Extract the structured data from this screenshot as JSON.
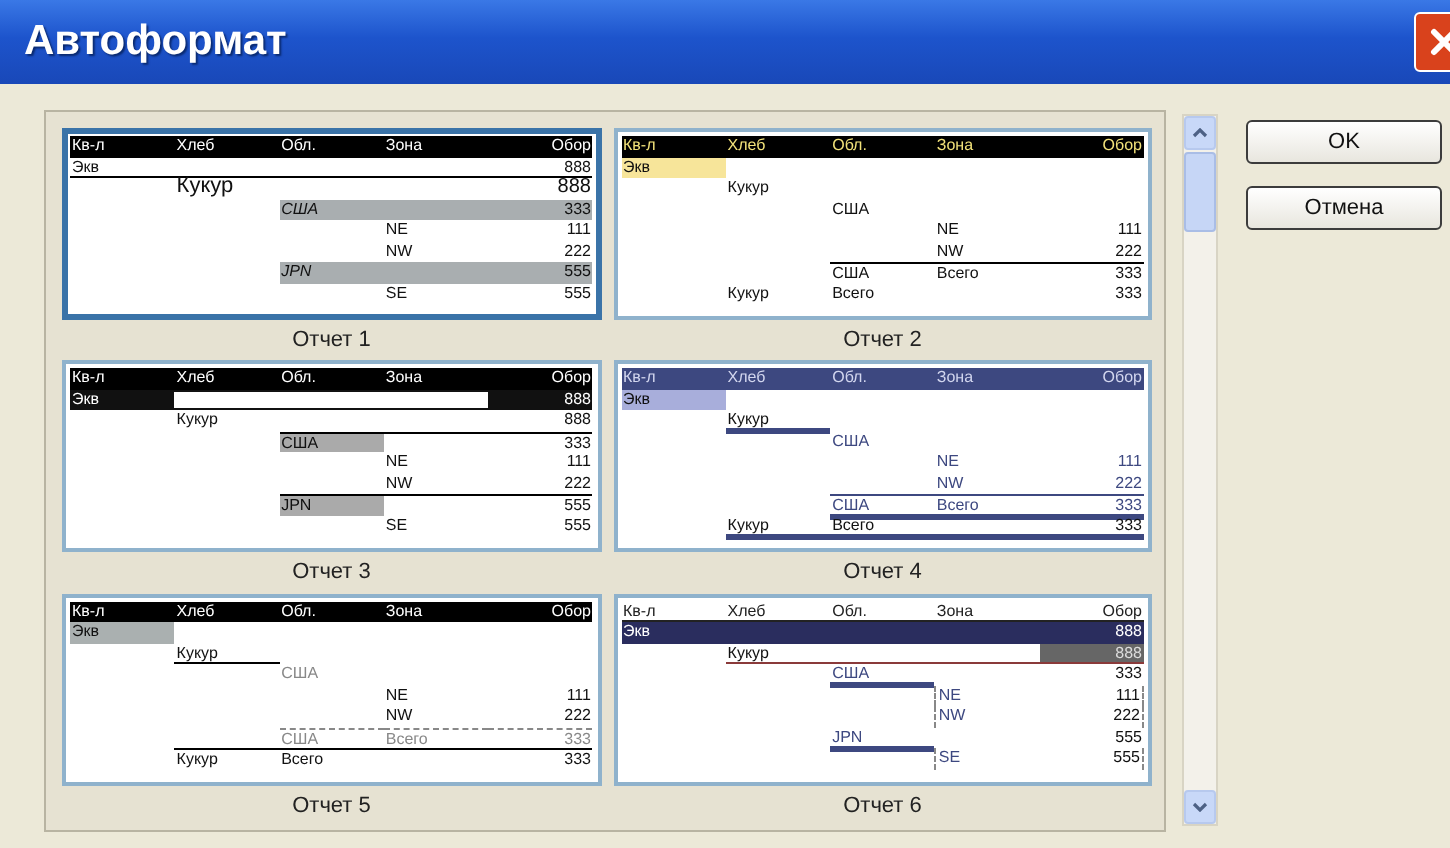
{
  "window": {
    "title": "Автоформат"
  },
  "reports": [
    {
      "label": "Отчет 1",
      "selected": true,
      "columns": [
        "Кв-л",
        "Хлеб",
        "Обл.",
        "Зона",
        "Обор"
      ],
      "rows": [
        {
          "kind": "total",
          "quarter": "Экв",
          "total": "888"
        },
        {
          "kind": "product",
          "bread": "Кукур",
          "total": "888"
        },
        {
          "kind": "region",
          "region": "США",
          "total": "333"
        },
        {
          "kind": "zone",
          "zone": "NE",
          "total": "111"
        },
        {
          "kind": "zone",
          "zone": "NW",
          "total": "222"
        },
        {
          "kind": "region",
          "region": "JPN",
          "total": "555"
        },
        {
          "kind": "zone",
          "zone": "SE",
          "total": "555"
        }
      ]
    },
    {
      "label": "Отчет 2",
      "selected": false,
      "columns": [
        "Кв-л",
        "Хлеб",
        "Обл.",
        "Зона",
        "Обор"
      ],
      "rows": [
        {
          "kind": "total",
          "quarter": "Экв"
        },
        {
          "kind": "product",
          "bread": "Кукур"
        },
        {
          "kind": "region",
          "region": "США"
        },
        {
          "kind": "zone",
          "zone": "NE",
          "total": "111"
        },
        {
          "kind": "zone",
          "zone": "NW",
          "total": "222"
        },
        {
          "kind": "subtotal",
          "region": "США",
          "zone": "Всего",
          "total": "333"
        },
        {
          "kind": "grand",
          "bread": "Кукур",
          "region": "Всего",
          "total": "333"
        }
      ]
    },
    {
      "label": "Отчет 3",
      "selected": false,
      "columns": [
        "Кв-л",
        "Хлеб",
        "Обл.",
        "Зона",
        "Обор"
      ],
      "rows": [
        {
          "kind": "total",
          "quarter": "Экв",
          "total": "888"
        },
        {
          "kind": "product",
          "bread": "Кукур",
          "total": "888"
        },
        {
          "kind": "region",
          "region": "США",
          "total": "333"
        },
        {
          "kind": "zone",
          "zone": "NE",
          "total": "111"
        },
        {
          "kind": "zone",
          "zone": "NW",
          "total": "222"
        },
        {
          "kind": "region",
          "region": "JPN",
          "total": "555"
        },
        {
          "kind": "zone",
          "zone": "SE",
          "total": "555"
        }
      ]
    },
    {
      "label": "Отчет 4",
      "selected": false,
      "columns": [
        "Кв-л",
        "Хлеб",
        "Обл.",
        "Зона",
        "Обор"
      ],
      "rows": [
        {
          "kind": "total",
          "quarter": "Экв"
        },
        {
          "kind": "product",
          "bread": "Кукур"
        },
        {
          "kind": "region",
          "region": "США"
        },
        {
          "kind": "zone",
          "zone": "NE",
          "total": "111"
        },
        {
          "kind": "zone",
          "zone": "NW",
          "total": "222"
        },
        {
          "kind": "subtotal",
          "region": "США",
          "zone": "Всего",
          "total": "333"
        },
        {
          "kind": "grand",
          "bread": "Кукур",
          "region": "Всего",
          "total": "333"
        }
      ]
    },
    {
      "label": "Отчет 5",
      "selected": false,
      "columns": [
        "Кв-л",
        "Хлеб",
        "Обл.",
        "Зона",
        "Обор"
      ],
      "rows": [
        {
          "kind": "total",
          "quarter": "Экв"
        },
        {
          "kind": "product",
          "bread": "Кукур"
        },
        {
          "kind": "region",
          "region": "США"
        },
        {
          "kind": "zone",
          "zone": "NE",
          "total": "111"
        },
        {
          "kind": "zone",
          "zone": "NW",
          "total": "222"
        },
        {
          "kind": "subtotal",
          "region": "США",
          "zone": "Всего",
          "total": "333"
        },
        {
          "kind": "grand",
          "bread": "Кукур",
          "region": "Всего",
          "total": "333"
        }
      ]
    },
    {
      "label": "Отчет 6",
      "selected": false,
      "columns": [
        "Кв-л",
        "Хлеб",
        "Обл.",
        "Зона",
        "Обор"
      ],
      "rows": [
        {
          "kind": "total",
          "quarter": "Экв",
          "total": "888"
        },
        {
          "kind": "product",
          "bread": "Кукур",
          "total": "888"
        },
        {
          "kind": "region",
          "region": "США",
          "total": "333"
        },
        {
          "kind": "zone",
          "zone": "NE",
          "total": "111"
        },
        {
          "kind": "zone",
          "zone": "NW",
          "total": "222"
        },
        {
          "kind": "region",
          "region": "JPN",
          "total": "555"
        },
        {
          "kind": "zone",
          "zone": "SE",
          "total": "555"
        }
      ]
    }
  ],
  "buttons": [
    "OK",
    "Отмена"
  ]
}
